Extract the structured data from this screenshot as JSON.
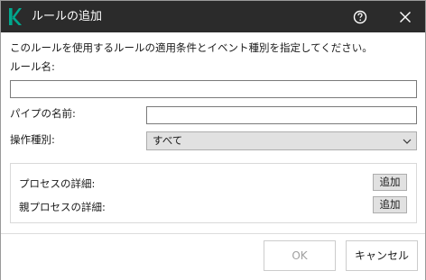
{
  "window": {
    "title": "ルールの追加",
    "logo_icon": "kaspersky-k-logo",
    "title_bar_color": "#2b2b2b",
    "logo_color": "#00a88e"
  },
  "form": {
    "description": "このルールを使用するルールの適用条件とイベント種別を指定してください。",
    "rule_name_label": "ルール名:",
    "rule_name_value": "",
    "pipe_name_label": "パイプの名前:",
    "pipe_name_value": "",
    "operation_type_label": "操作種別:",
    "operation_type_selected": "すべて"
  },
  "process_details": {
    "process_label": "プロセスの詳細:",
    "process_add_label": "追加",
    "parent_process_label": "親プロセスの詳細:",
    "parent_process_add_label": "追加"
  },
  "footer": {
    "ok_label": "OK",
    "cancel_label": "キャンセル"
  }
}
